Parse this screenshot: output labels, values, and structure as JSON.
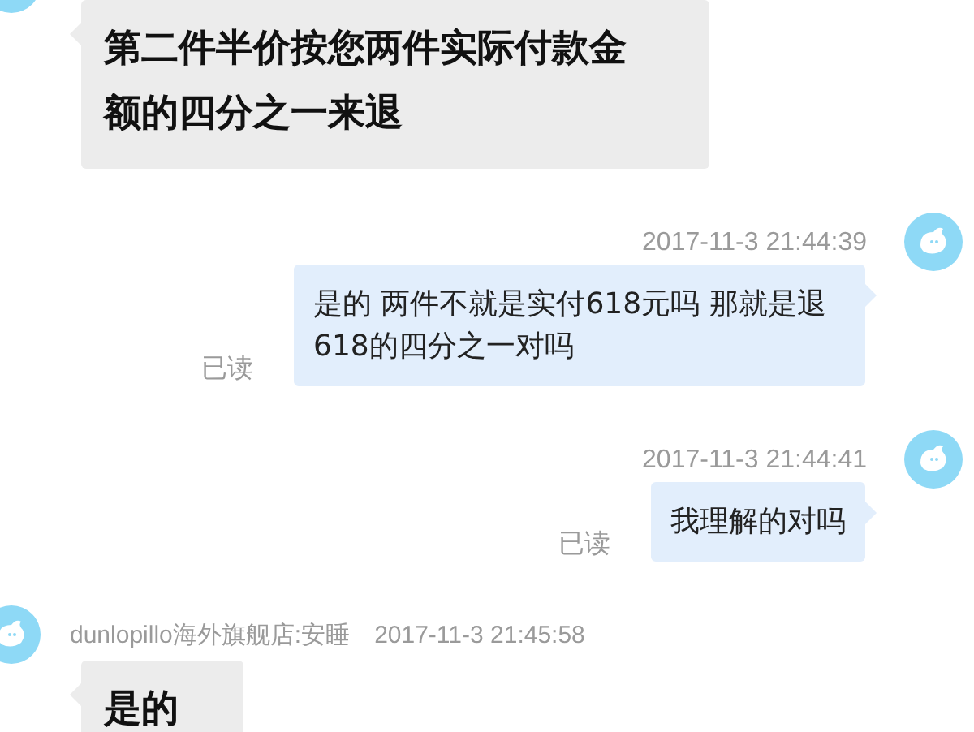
{
  "messages": [
    {
      "kind": "incoming",
      "text": "第二件半价按您两件实际付款金额的四分之一来退"
    },
    {
      "kind": "outgoing",
      "time": "2017-11-3 21:44:39",
      "text": "是的 两件不就是实付618元吗 那就是退618的四分之一对吗",
      "status": "已读"
    },
    {
      "kind": "outgoing",
      "time": "2017-11-3 21:44:41",
      "text": "我理解的对吗",
      "status": "已读"
    },
    {
      "kind": "incoming",
      "sender": "dunlopillo海外旗舰店:安睡",
      "time": "2017-11-3 21:45:58",
      "text": "是的"
    }
  ]
}
